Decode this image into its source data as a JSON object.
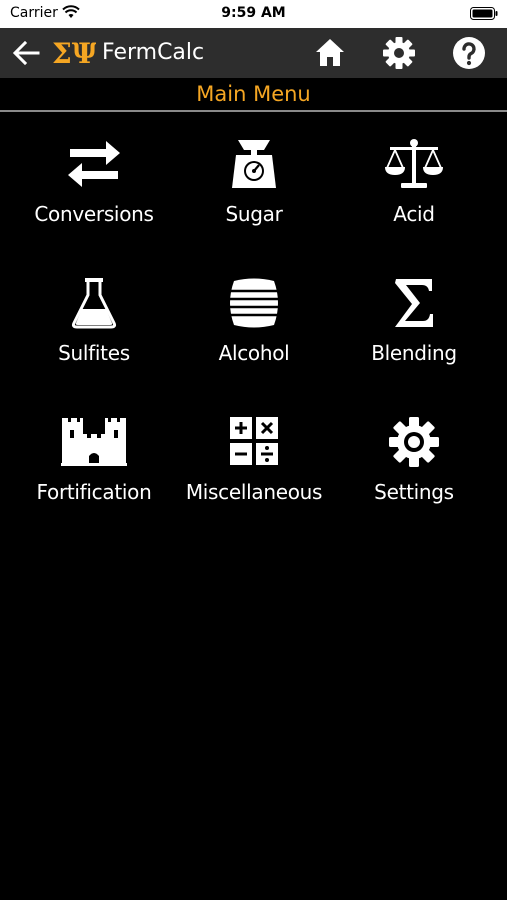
{
  "status_bar": {
    "carrier": "Carrier",
    "time": "9:59 AM"
  },
  "nav_bar": {
    "app_title": "FermCalc",
    "logo_text": "ΣΨ",
    "icons": [
      "back-arrow-icon",
      "home-icon",
      "gear-icon",
      "help-icon"
    ]
  },
  "header": {
    "title": "Main Menu"
  },
  "menu": {
    "items": [
      {
        "label": "Conversions",
        "icon": "exchange-arrows-icon"
      },
      {
        "label": "Sugar",
        "icon": "scale-icon"
      },
      {
        "label": "Acid",
        "icon": "balance-icon"
      },
      {
        "label": "Sulfites",
        "icon": "flask-icon"
      },
      {
        "label": "Alcohol",
        "icon": "barrel-icon"
      },
      {
        "label": "Blending",
        "icon": "sigma-icon"
      },
      {
        "label": "Fortification",
        "icon": "castle-icon"
      },
      {
        "label": "Miscellaneous",
        "icon": "calculator-icon"
      },
      {
        "label": "Settings",
        "icon": "gear-icon"
      }
    ]
  },
  "colors": {
    "accent": "#f5a623",
    "nav_background": "#2d2d2d",
    "background": "#000000",
    "text": "#ffffff",
    "divider": "#8a8a8a"
  }
}
